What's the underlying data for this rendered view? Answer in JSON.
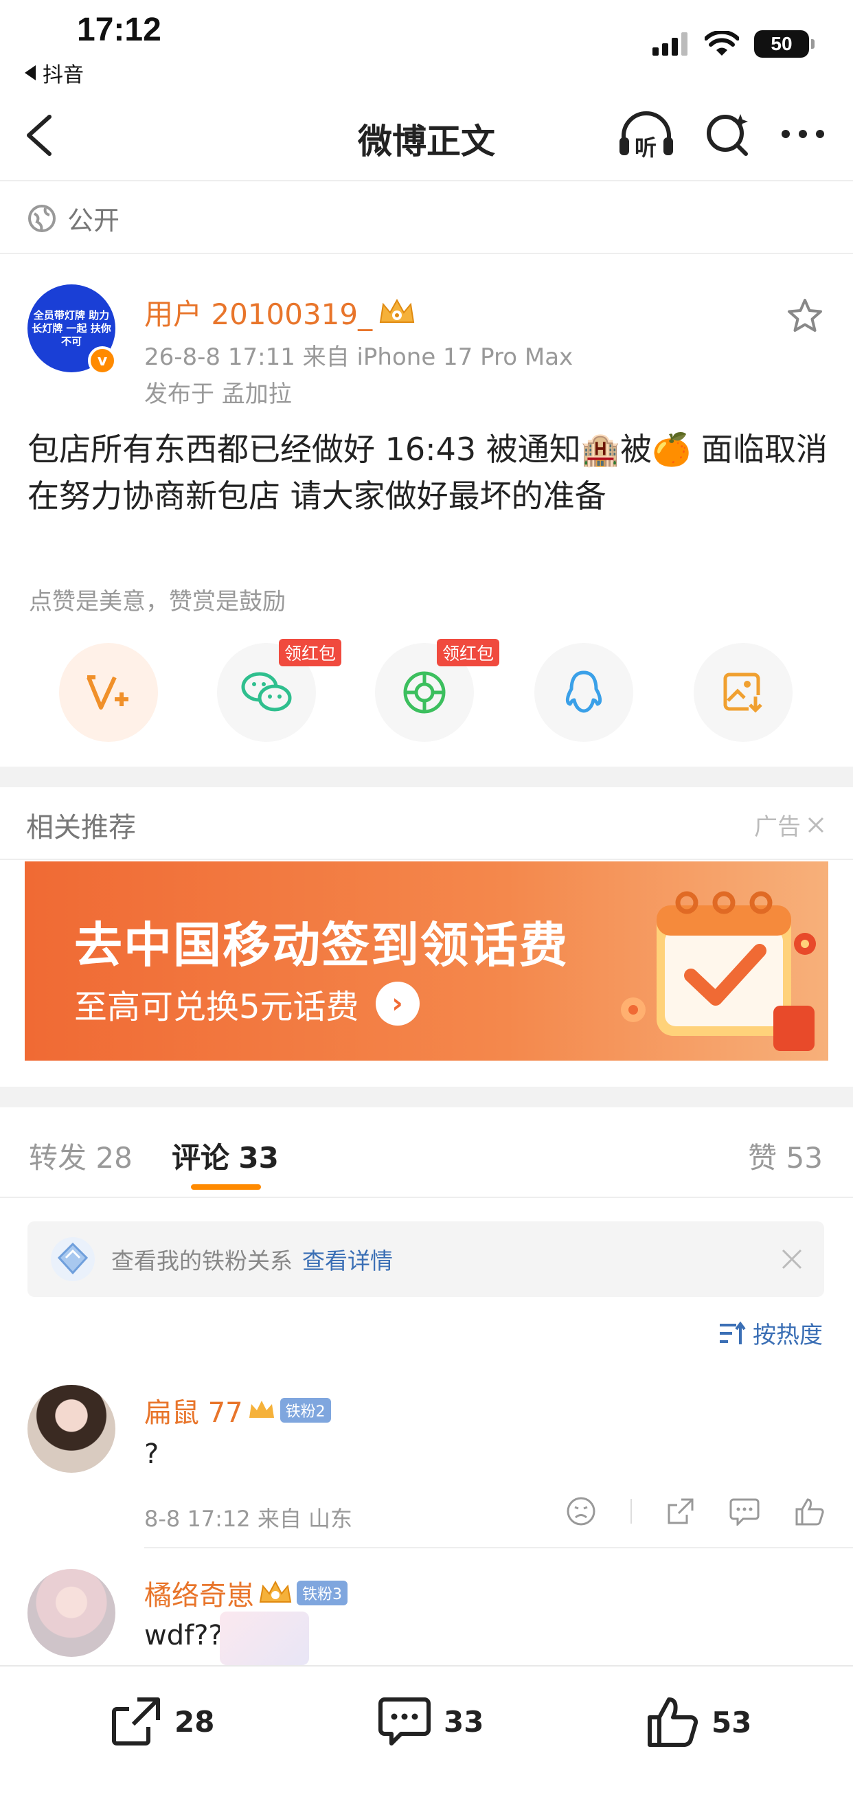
{
  "status_bar": {
    "time": "17:12",
    "back_app": "抖音",
    "battery": "50"
  },
  "nav": {
    "title": "微博正文",
    "listen_label": "听"
  },
  "visibility": "公开",
  "post": {
    "avatar_text": "全员带灯牌 助力长灯牌 一起 扶你不可",
    "username": "用户 20100319_",
    "time_source": "26-8-8 17:11  来自 iPhone 17 Pro Max",
    "location": "发布于 孟加拉",
    "text_part1": "包店所有东西都已经做好 16:43 被通知",
    "emoji_hotel": "🏨",
    "text_part2": "被",
    "emoji_orange": "🍊",
    "text_part3": " 面临取消 在努力协商新包店 请大家做好最坏的准备"
  },
  "like_hint": "点赞是美意，赞赏是鼓励",
  "share": {
    "red_tag_1": "领红包",
    "red_tag_2": "领红包"
  },
  "recommend": {
    "title": "相关推荐",
    "ad_label": "广告",
    "banner_title": "去中国移动签到领话费",
    "banner_sub": "至高可兑换5元话费"
  },
  "tabs": {
    "repost_label": "转发",
    "repost_count": "28",
    "comment_label": "评论",
    "comment_count": "33",
    "like_label": "赞",
    "like_count": "53"
  },
  "iron_fans": {
    "text": "查看我的铁粉关系",
    "link": "查看详情"
  },
  "sort_label": "按热度",
  "comments": [
    {
      "name": "扁鼠 77",
      "badge": "铁粉2",
      "text": "?",
      "meta": "8-8 17:12  来自 山东"
    },
    {
      "name": "橘络奇崽",
      "badge": "铁粉3",
      "text": "wdf???"
    }
  ],
  "bottom_bar": {
    "repost": "28",
    "comment": "33",
    "like": "53"
  },
  "colors": {
    "accent_orange": "#ff8a00",
    "name_orange": "#e8752b",
    "link_blue": "#3b6fb5"
  }
}
